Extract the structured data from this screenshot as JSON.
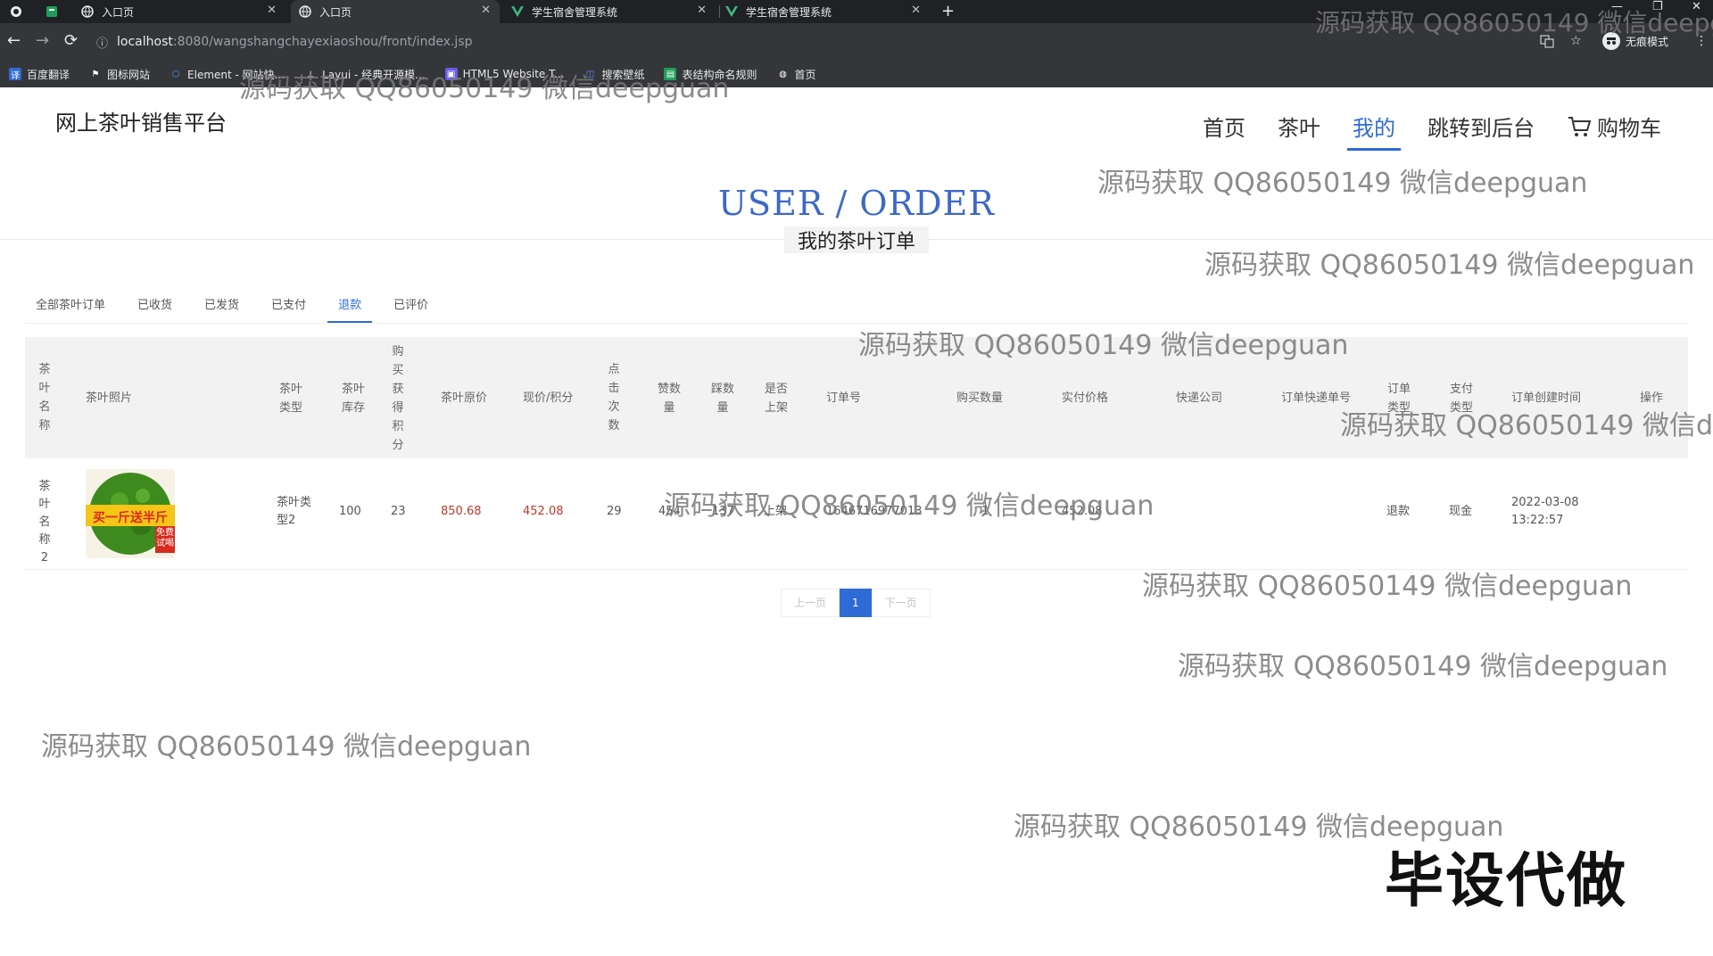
{
  "browser": {
    "tabs": [
      {
        "label": "",
        "icon": "grid-icon"
      },
      {
        "label": "",
        "icon": "sheet-icon"
      },
      {
        "label": "入口页",
        "icon": "globe-icon"
      },
      {
        "label": "入口页",
        "icon": "globe-icon"
      },
      {
        "label": "学生宿舍管理系统",
        "icon": "vue-icon"
      },
      {
        "label": "学生宿舍管理系统",
        "icon": "vue-icon"
      }
    ],
    "url_host": "localhost",
    "url_path": ":8080/wangshangchayexiaoshou/front/index.jsp",
    "incognito_label": "无痕模式",
    "bookmarks": [
      {
        "label": "百度翻译",
        "color": "#2f6bd6"
      },
      {
        "label": "图标网站",
        "color": "#ffffff"
      },
      {
        "label": "Element - 网站快...",
        "color": "#409eff"
      },
      {
        "label": "Layui - 经典开源模...",
        "color": "#ffffff"
      },
      {
        "label": "HTML5 Website T...",
        "color": "#6c5ce7"
      },
      {
        "label": "搜索壁纸",
        "color": "#2b5fd9"
      },
      {
        "label": "表结构命名规则",
        "color": "#1e9e5a"
      },
      {
        "label": "首页",
        "color": "#ffffff"
      }
    ]
  },
  "site": {
    "brand": "网上茶叶销售平台",
    "nav": [
      {
        "label": "首页",
        "active": false
      },
      {
        "label": "茶叶",
        "active": false
      },
      {
        "label": "我的",
        "active": true
      },
      {
        "label": "跳转到后台",
        "active": false
      }
    ],
    "cart_label": "购物车",
    "accent": "#2f6bd6"
  },
  "section": {
    "title": "USER / ORDER",
    "subtitle": "我的茶叶订单"
  },
  "order_tabs": [
    {
      "label": "全部茶叶订单",
      "active": false
    },
    {
      "label": "已收货",
      "active": false
    },
    {
      "label": "已发货",
      "active": false
    },
    {
      "label": "已支付",
      "active": false
    },
    {
      "label": "退款",
      "active": true
    },
    {
      "label": "已评价",
      "active": false
    }
  ],
  "table": {
    "headers": {
      "name": "茶叶名称",
      "photo": "茶叶照片",
      "type": "茶叶类型",
      "stock": "茶叶库存",
      "points": "购买获得积分",
      "price": "茶叶原价",
      "current": "现价/积分",
      "clicks": "点击次数",
      "likes": "赞数量",
      "dislikes": "踩数量",
      "onshelf": "是否上架",
      "order_no": "订单号",
      "qty": "购买数量",
      "paid": "实付价格",
      "courier": "快递公司",
      "tracking": "订单快递单号",
      "order_type": "订单类型",
      "pay_type": "支付类型",
      "created": "订单创建时间",
      "actions": "操作"
    },
    "rows": [
      {
        "name": "茶叶名称2",
        "photo_text": "买一斤送半斤",
        "photo_badge": "免费试喝",
        "type": "茶叶类型2",
        "stock": "100",
        "points": "23",
        "price": "850.68",
        "current": "452.08",
        "clicks": "29",
        "likes": "454",
        "dislikes": "137",
        "onshelf": "上架",
        "order_no": "1646716977013",
        "qty": "1",
        "paid": "452.08",
        "courier": "",
        "tracking": "",
        "order_type": "退款",
        "pay_type": "现金",
        "created_date": "2022-03-08",
        "created_time": "13:22:57"
      }
    ]
  },
  "pager": {
    "prev": "上一页",
    "current": "1",
    "next": "下一页"
  },
  "watermark": {
    "text": "源码获取 QQ86050149 微信deepguan",
    "stamp": "毕设代做"
  }
}
